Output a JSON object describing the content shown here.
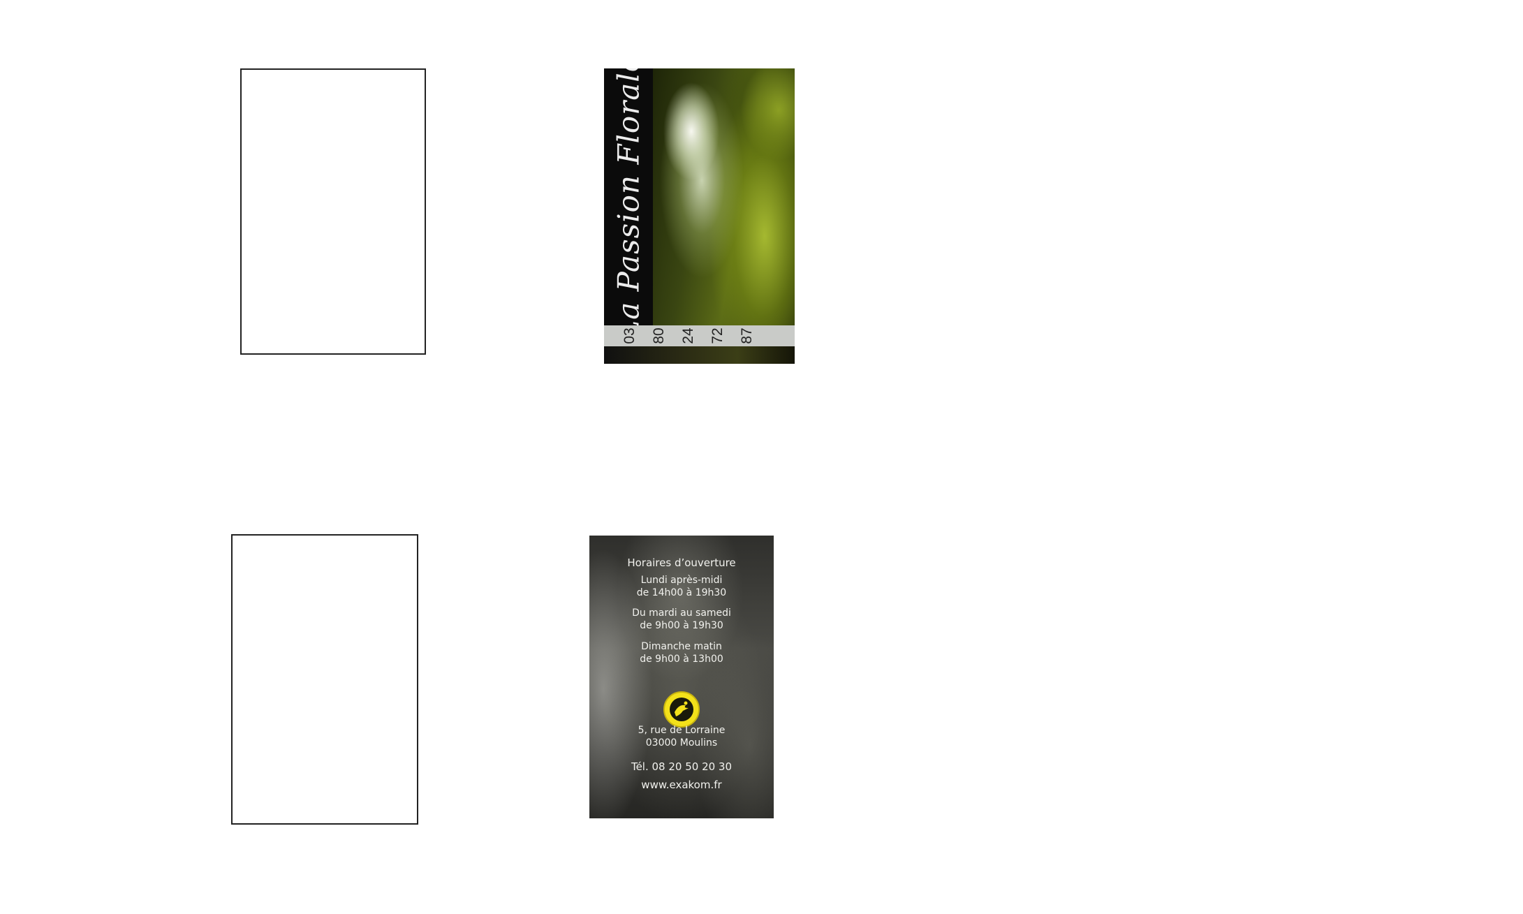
{
  "front_card": {
    "title": "La Passion Florale",
    "phone_digits": [
      "03",
      "80",
      "24",
      "72",
      "87"
    ]
  },
  "back_card": {
    "hours_heading": "Horaires d’ouverture",
    "hours": [
      {
        "day": "Lundi après-midi",
        "time": "de 14h00 à 19h30"
      },
      {
        "day": "Du mardi au samedi",
        "time": "de 9h00 à 19h30"
      },
      {
        "day": "Dimanche matin",
        "time": "de 9h00 à 13h00"
      }
    ],
    "address_line1": "5, rue de Lorraine",
    "address_line2": "03000 Moulins",
    "phone": "Tél. 08 20 50 20 30",
    "website": "www.exakom.fr",
    "logo_icon": "interflora-logo-icon"
  },
  "colors": {
    "front_green": "#5b6b16",
    "logo_yellow": "#f3e11a",
    "back_gray": "#4a4a45"
  }
}
